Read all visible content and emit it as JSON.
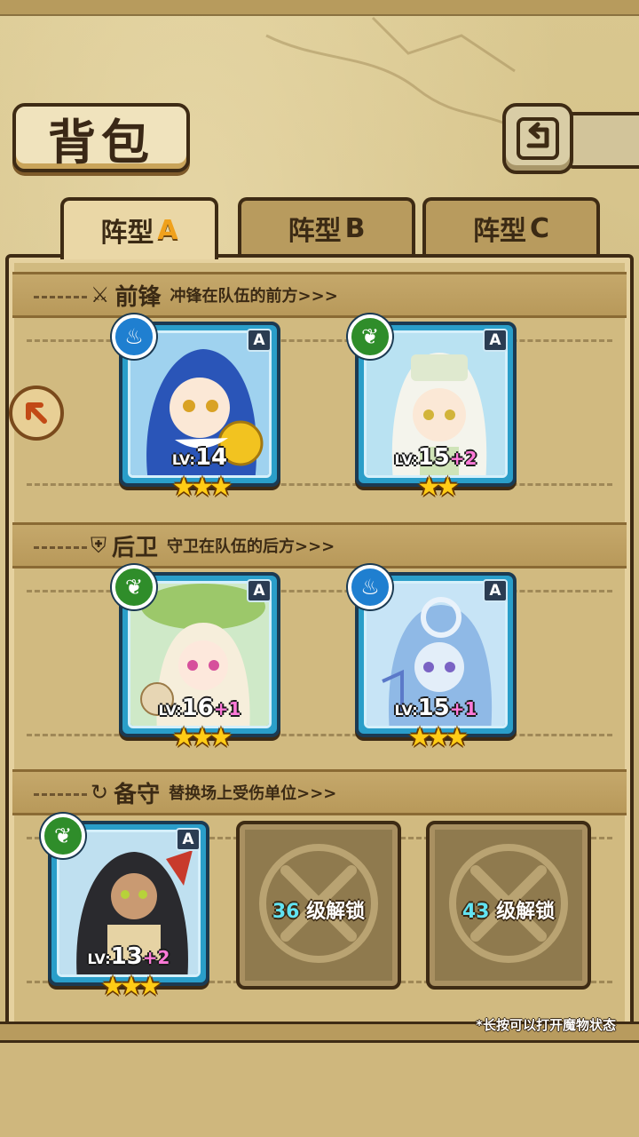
{
  "header": {
    "title": "背包",
    "back_icon": "return-arrow-icon"
  },
  "tabs": [
    {
      "label": "阵型",
      "suffix": "A",
      "active": true
    },
    {
      "label": "阵型",
      "suffix": "B",
      "active": false
    },
    {
      "label": "阵型",
      "suffix": "C",
      "active": false
    }
  ],
  "sections": {
    "front": {
      "name": "前锋",
      "desc": "冲锋在队伍的前方>>>",
      "icon": "sword-icon"
    },
    "back": {
      "name": "后卫",
      "desc": "守卫在队伍的后方>>>",
      "icon": "shield-icon"
    },
    "reserve": {
      "name": "备守",
      "desc": "替换场上受伤单位>>>",
      "icon": "swap-icon"
    }
  },
  "cards": [
    {
      "lv_prefix": "LV:",
      "level": "14",
      "plus": "",
      "rank": "A",
      "element": "water",
      "stars": "★★★"
    },
    {
      "lv_prefix": "LV:",
      "level": "15",
      "plus": "+2",
      "rank": "A",
      "element": "leaf",
      "stars": "★★"
    },
    {
      "lv_prefix": "LV:",
      "level": "16",
      "plus": "+1",
      "rank": "A",
      "element": "leaf",
      "stars": "★★★"
    },
    {
      "lv_prefix": "LV:",
      "level": "15",
      "plus": "+1",
      "rank": "A",
      "element": "water",
      "stars": "★★★"
    },
    {
      "lv_prefix": "LV:",
      "level": "13",
      "plus": "+2",
      "rank": "A",
      "element": "leaf",
      "stars": "★★★"
    }
  ],
  "locked_slots": [
    {
      "level": "36",
      "text": "级解锁"
    },
    {
      "level": "43",
      "text": "级解锁"
    }
  ],
  "hint": "*长按可以打开魔物状态",
  "colors": {
    "accent": "#f0a11c",
    "card_border": "#2a9ec9",
    "plus": "#ff7ad9",
    "star": "#ffcc16"
  }
}
